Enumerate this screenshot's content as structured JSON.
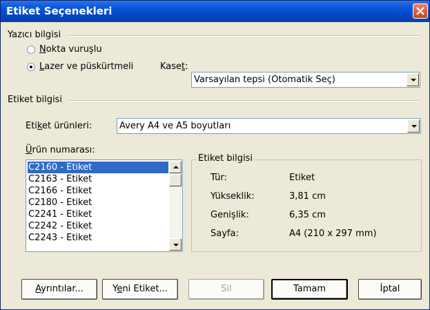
{
  "window": {
    "title": "Etiket Seçenekleri"
  },
  "printer_section": {
    "label": "Yazıcı bilgisi",
    "radio_dot_matrix": {
      "prefix": "",
      "mnemonic": "N",
      "rest": "okta vuruşlu",
      "checked": false
    },
    "radio_laser": {
      "prefix": "",
      "mnemonic": "L",
      "rest": "azer ve püskürtmeli",
      "checked": true
    },
    "tray": {
      "prefix": "Kase",
      "mnemonic": "t",
      "rest": ":",
      "value": "Varsayılan tepsi (Otomatik Seç)"
    }
  },
  "label_section": {
    "label": "Etiket bilgisi",
    "products": {
      "prefix": "Eti",
      "mnemonic": "k",
      "rest": "et ürünleri:",
      "value": "Avery A4 ve A5 boyutları"
    },
    "product_number": {
      "prefix": "",
      "mnemonic": "Ü",
      "rest": "rün numarası:"
    },
    "items": [
      "C2160 - Etiket",
      "C2163 - Etiket",
      "C2166 - Etiket",
      "C2180 - Etiket",
      "C2241 - Etiket",
      "C2242 - Etiket",
      "C2243 - Etiket"
    ],
    "selected_index": 0
  },
  "label_info": {
    "title": "Etiket bilgisi",
    "rows": [
      {
        "key": "Tür:",
        "value": "Etiket"
      },
      {
        "key": "Yükseklik:",
        "value": "3,81 cm"
      },
      {
        "key": "Genişlik:",
        "value": "6,35 cm"
      },
      {
        "key": "Sayfa:",
        "value": "A4 (210 x 297 mm)"
      }
    ]
  },
  "buttons": {
    "details": {
      "prefix": "",
      "mnemonic": "A",
      "rest": "yrıntılar..."
    },
    "new_label": {
      "prefix": "Y",
      "mnemonic": "e",
      "rest": "ni Etiket..."
    },
    "delete": {
      "label": "Sil",
      "disabled": true
    },
    "ok": {
      "label": "Tamam"
    },
    "cancel": {
      "label": "İptal"
    }
  },
  "colors": {
    "title_bar": "#0a58d8",
    "selection": "#316ac5",
    "dialog_bg": "#ece9d8"
  },
  "icons": {
    "close": "close-icon",
    "dropdown": "chevron-down-icon"
  }
}
